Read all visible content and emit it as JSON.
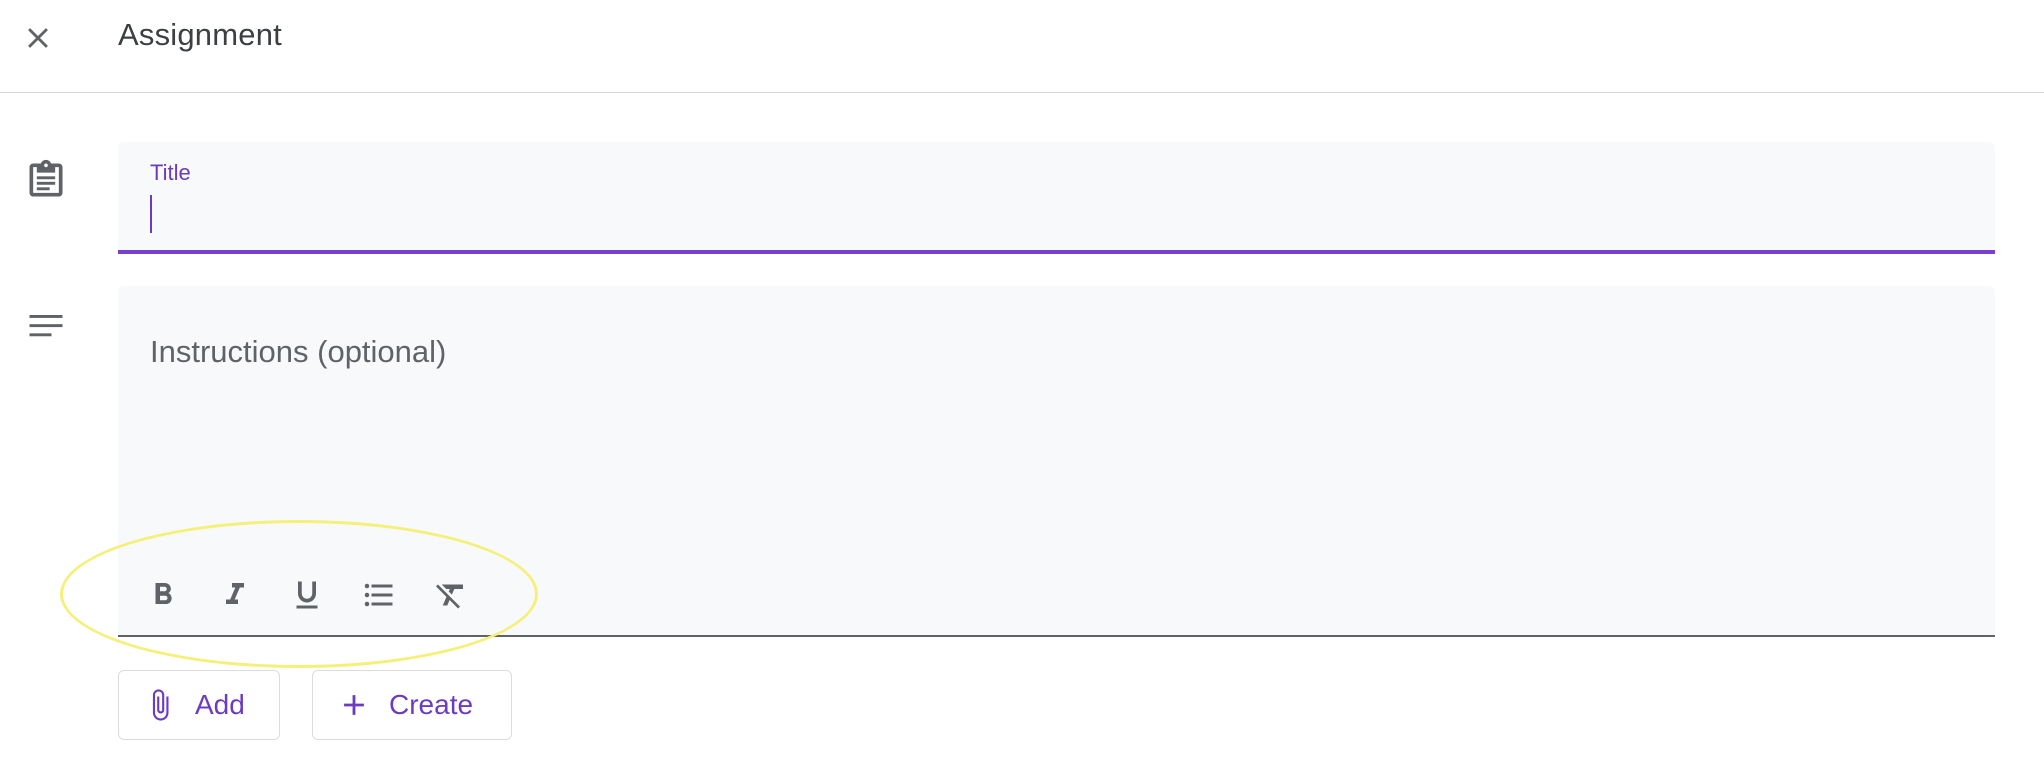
{
  "header": {
    "title": "Assignment",
    "close_icon": "close-icon"
  },
  "title_field": {
    "label": "Title",
    "value": ""
  },
  "instructions_field": {
    "placeholder": "Instructions (optional)"
  },
  "toolbar": {
    "buttons": [
      {
        "name": "bold",
        "icon": "bold-icon"
      },
      {
        "name": "italic",
        "icon": "italic-icon"
      },
      {
        "name": "underline",
        "icon": "underline-icon"
      },
      {
        "name": "bulleted-list",
        "icon": "bulleted-list-icon"
      },
      {
        "name": "clear-formatting",
        "icon": "clear-formatting-icon"
      }
    ]
  },
  "actions": {
    "add_label": "Add",
    "create_label": "Create"
  },
  "colors": {
    "accent": "#6b3cc2",
    "focus_underline": "#7a3fcf",
    "icon_gray": "#5f6368",
    "field_bg": "#f8f9fa",
    "annotation": "#f5f07a"
  }
}
